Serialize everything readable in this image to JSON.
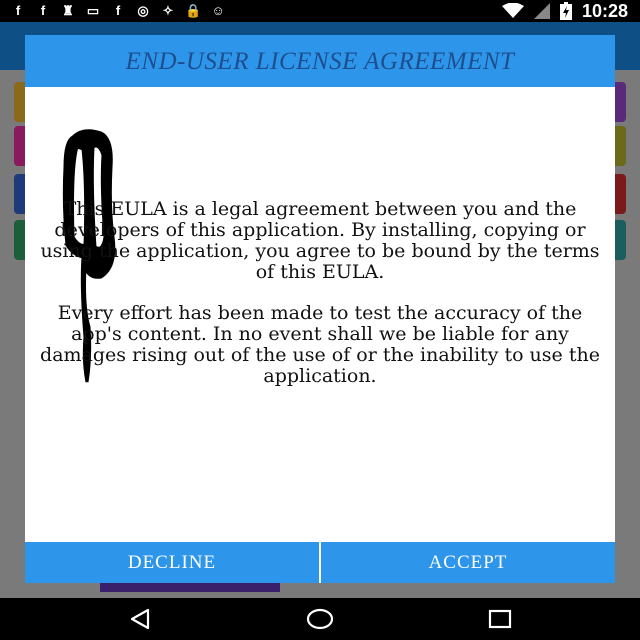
{
  "status_bar": {
    "icons": [
      "facebook-icon",
      "facebook-icon",
      "chess-pawn-icon",
      "message-icon",
      "facebook-icon",
      "circle-icon",
      "satellite-icon",
      "lock-icon",
      "android-icon"
    ],
    "icon_glyphs": [
      "f",
      "f",
      "♜",
      "▭",
      "f",
      "◎",
      "✧",
      "🔒",
      "☺"
    ],
    "time": "10:28"
  },
  "dialog": {
    "title": "END-USER LICENSE AGREEMENT",
    "paragraphs": [
      "This EULA is a legal agreement between you and the developers of this application. By installing, copying or using the application, you agree to be bound by the terms of this EULA.",
      "Every effort has been made to test the accuracy of the app's content. In no event shall we be liable for any damages rising out of the use of or the inability to use the application."
    ],
    "decline_label": "DECLINE",
    "accept_label": "ACCEPT"
  },
  "colors": {
    "header_bg": "#2d96ea",
    "title_text": "#1e4e8e",
    "app_bar": "#0e4f86"
  },
  "nav_bar": {
    "buttons": [
      "back-icon",
      "home-icon",
      "recents-icon"
    ]
  }
}
